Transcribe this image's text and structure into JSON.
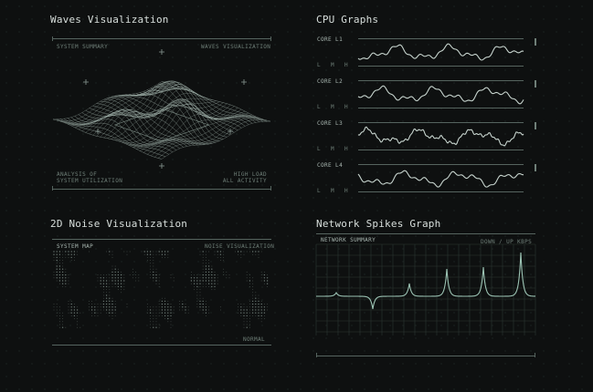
{
  "panels": {
    "waves": {
      "title": "Waves Visualization",
      "top_left": "SYSTEM SUMMARY",
      "top_right": "WAVES VISUALIZATION",
      "bottom_left": [
        "ANALYSIS OF",
        "SYSTEM UTILIZATION"
      ],
      "bottom_right": [
        "HIGH LOAD",
        "ALL ACTIVITY"
      ]
    },
    "cpu": {
      "title": "CPU Graphs",
      "cores": [
        {
          "label": "CORE L1"
        },
        {
          "label": "CORE L2"
        },
        {
          "label": "CORE L3"
        },
        {
          "label": "CORE L4"
        }
      ],
      "scale": [
        "L",
        "M",
        "H"
      ]
    },
    "noise": {
      "title": "2D Noise Visualization",
      "top_left": "SYSTEM MAP",
      "top_right": "NOISE VISUALIZATION",
      "bottom_right": "NORMAL"
    },
    "network": {
      "title": "Network Spikes Graph",
      "top_left": "NETWORK SUMMARY",
      "top_right": "DOWN / UP KBPS"
    }
  },
  "colors": {
    "background": "#0e1010",
    "line": "#c6d3cd",
    "accent": "#7fa597",
    "rule": "#56645f"
  }
}
